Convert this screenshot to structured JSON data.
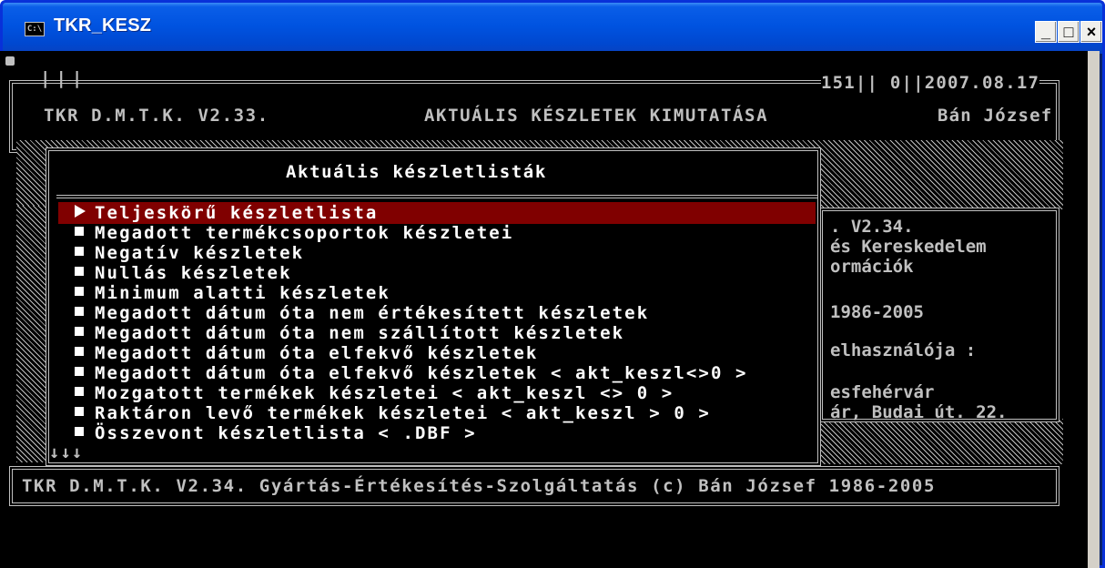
{
  "window": {
    "title": "TKR_KESZ",
    "icon_text": "C:\\",
    "buttons": {
      "minimize": "_",
      "maximize": "□",
      "close": "×"
    }
  },
  "header": {
    "app_version": "TKR D.M.T.K. V2.33.",
    "screen_title": "AKTUÁLIS KÉSZLETEK KIMUTATÁSA",
    "status": "151|| 0||2007.08.17",
    "user": "Bán József"
  },
  "background_panel": {
    "lines": [
      ". V2.34.",
      "és Kereskedelem",
      "ormációk",
      "",
      "1986-2005",
      "",
      "elhasználója :",
      "",
      "esfehérvár",
      "ár, Budai út. 22."
    ]
  },
  "menu": {
    "title": "Aktuális készletlisták",
    "selected_index": 0,
    "items": [
      "Teljeskörű készletlista",
      "Megadott termékcsoportok készletei",
      "Negatív készletek",
      "Nullás készletek",
      "Minimum alatti készletek",
      "Megadott dátum óta nem értékesített készletek",
      "Megadott dátum óta nem szállított készletek",
      "Megadott dátum óta elfekvő készletek",
      "Megadott dátum óta elfekvő készletek < akt_keszl<>0 >",
      "Mozgatott termékek készletei < akt_keszl <> 0 >",
      "Raktáron levő termékek készletei < akt_keszl > 0 >",
      "Összevont készletlista < .DBF >"
    ],
    "more_indicator": "↓↓↓"
  },
  "footer": {
    "text": "TKR D.M.T.K. V2.34. Gyártás-Értékesítés-Szolgáltatás (c) Bán József 1986-2005"
  },
  "colors": {
    "console_bg": "#000000",
    "console_text": "#c0c0c0",
    "highlight": "#800000",
    "titlebar": "#0053e0"
  }
}
